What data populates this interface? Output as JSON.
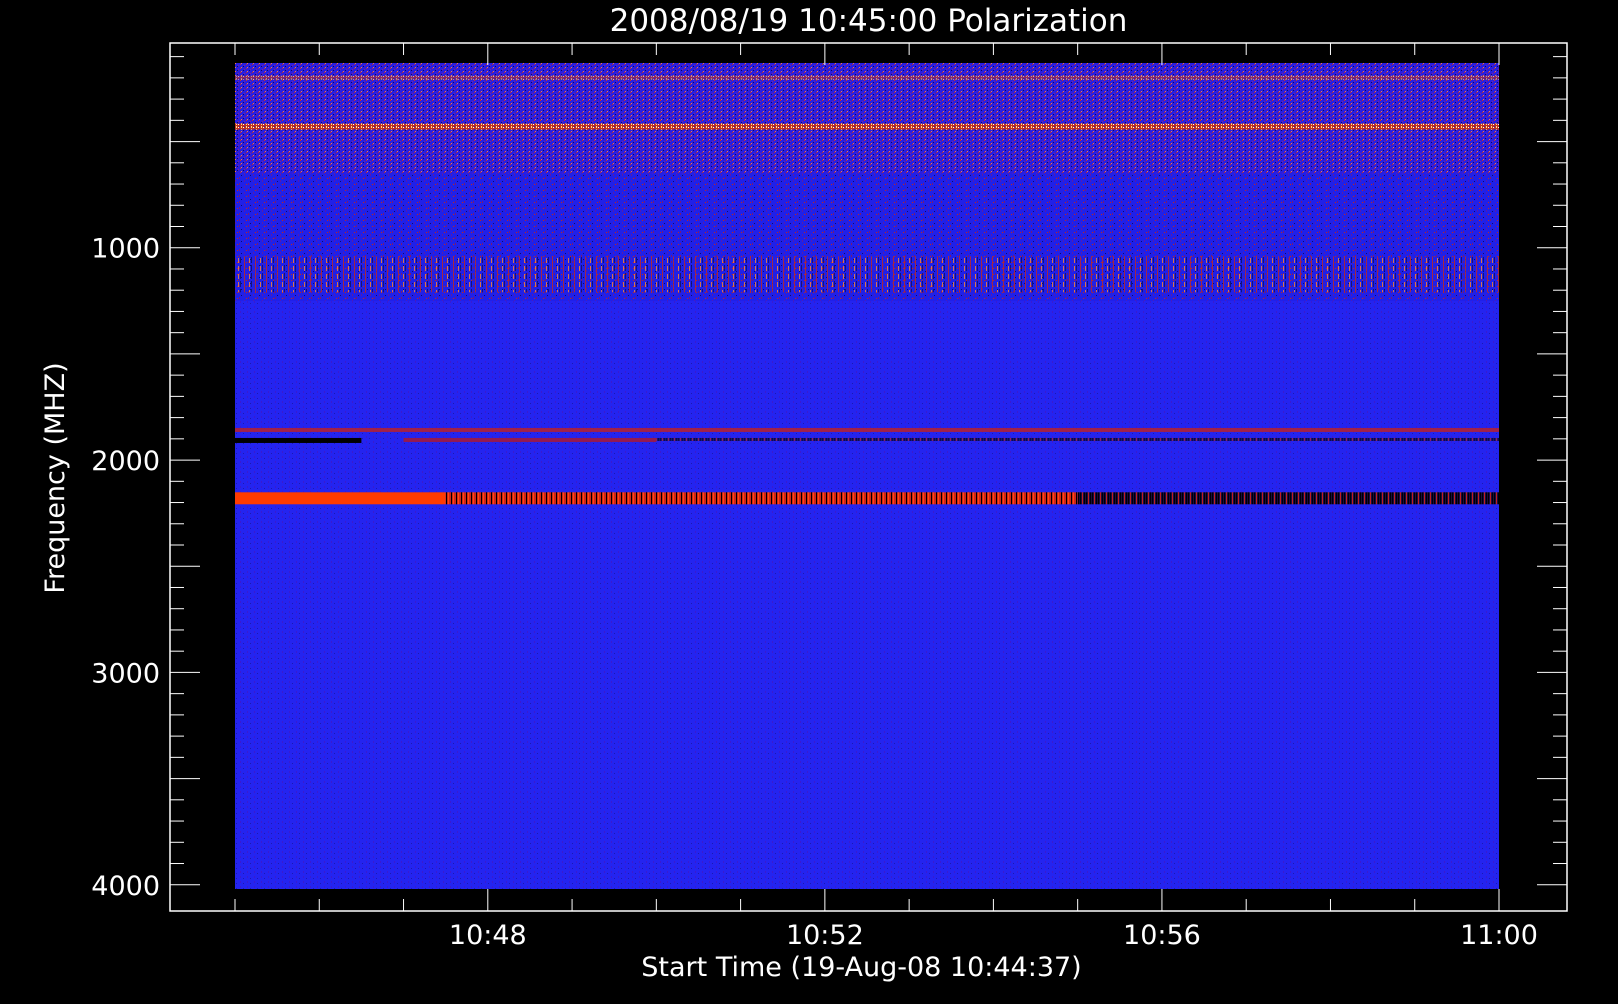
{
  "chart_data": {
    "type": "heatmap",
    "title": "2008/08/19 10:45:00 Polarization",
    "xlabel": "Start Time (19-Aug-08 10:44:37)",
    "ylabel": "Frequency (MHZ)",
    "x_range": [
      "10:45:00",
      "11:00:00"
    ],
    "y_range": [
      130,
      4020
    ],
    "y_inverted": true,
    "x_ticks": [
      "10:48",
      "10:52",
      "10:56",
      "11:00"
    ],
    "y_ticks": [
      1000,
      2000,
      3000,
      4000
    ],
    "colors": {
      "background": "#1f1fee",
      "positive": "#ff3b00",
      "strong": "#ffe37a",
      "negative": "#000000",
      "frame": "#ffffff"
    },
    "features": [
      {
        "label": "noisy low-frequency band",
        "freq_range": [
          130,
          650
        ]
      },
      {
        "label": "bright speckle line",
        "freq": 430
      },
      {
        "label": "sparse streak band",
        "freq": 1125
      },
      {
        "label": "dark/red split line",
        "freq": 1910
      },
      {
        "label": "strong red line (fades to dark after 10:55)",
        "freq": 2180
      }
    ]
  }
}
